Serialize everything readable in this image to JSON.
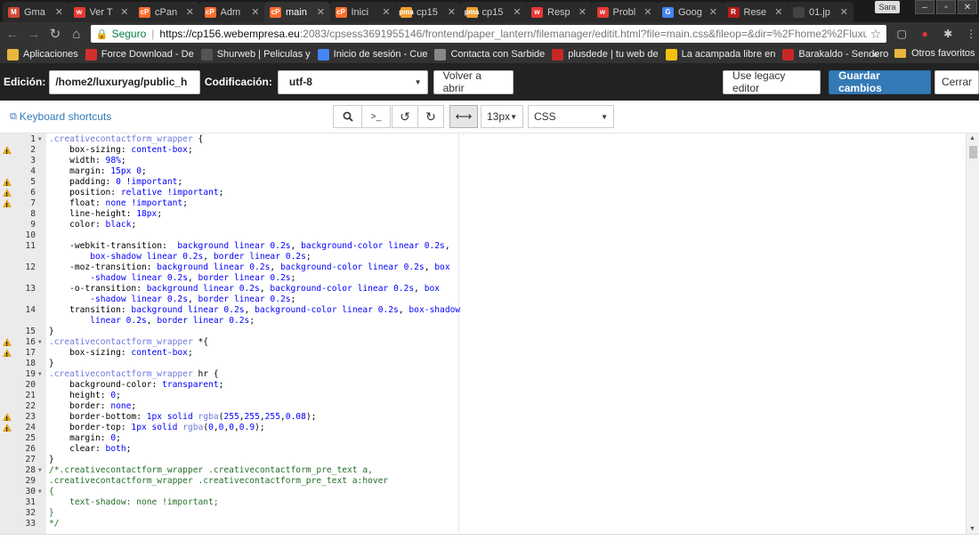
{
  "browser": {
    "tabs": [
      {
        "label": "Gma",
        "icon": "gmail-icon",
        "color": "#d14836",
        "glyph": "M"
      },
      {
        "label": "Ver T",
        "icon": "webempresa-icon",
        "color": "#e53935",
        "glyph": "w"
      },
      {
        "label": "cPan",
        "icon": "cpanel-icon",
        "color": "#ff6c2c",
        "glyph": "cP"
      },
      {
        "label": "Adm",
        "icon": "cpanel-icon",
        "color": "#ff6c2c",
        "glyph": "cP"
      },
      {
        "label": "main",
        "icon": "cpanel-icon",
        "color": "#ff6c2c",
        "glyph": "cP",
        "active": true
      },
      {
        "label": "Inici",
        "icon": "cpanel-icon",
        "color": "#ff6c2c",
        "glyph": "cP"
      },
      {
        "label": "cp15",
        "icon": "pma-icon",
        "color": "#f0a030",
        "glyph": "pma"
      },
      {
        "label": "cp15",
        "icon": "pma-icon",
        "color": "#f0a030",
        "glyph": "pma"
      },
      {
        "label": "Resp",
        "icon": "webempresa-icon",
        "color": "#e53935",
        "glyph": "w"
      },
      {
        "label": "Probl",
        "icon": "webempresa-icon",
        "color": "#e53935",
        "glyph": "w"
      },
      {
        "label": "Goog",
        "icon": "google-icon",
        "color": "#4285f4",
        "glyph": "G"
      },
      {
        "label": "Rese",
        "icon": "page-icon",
        "color": "#b71c1c",
        "glyph": "R"
      },
      {
        "label": "01.jp",
        "icon": "image-icon",
        "color": "#444444",
        "glyph": ""
      }
    ],
    "profile": "Sara",
    "url": {
      "secure_label": "Seguro",
      "host": "https://cp156.webempresa.eu",
      "rest": ":2083/cpsess3691955146/frontend/paper_lantern/filemanager/editit.html?file=main.css&fileop=&dir=%2Fhome2%2Fluxuryag%2..."
    },
    "bookmarks": [
      {
        "label": "Aplicaciones",
        "icon": "apps-icon",
        "color": "#e8b63f"
      },
      {
        "label": "Force Download - De",
        "icon": "force-download-icon",
        "color": "#d32f2f"
      },
      {
        "label": "Shurweb | Peliculas y",
        "icon": "shurweb-icon",
        "color": "#555555"
      },
      {
        "label": "Inicio de sesión - Cue",
        "icon": "google-icon",
        "color": "#4285f4"
      },
      {
        "label": "Contacta con Sarbide",
        "icon": "sarbide-icon",
        "color": "#888888"
      },
      {
        "label": "plusdede | tu web de",
        "icon": "plusdede-icon",
        "color": "#c62828"
      },
      {
        "label": "La acampada libre en",
        "icon": "acampada-icon",
        "color": "#f4c20d"
      },
      {
        "label": "Barakaldo - Sendero",
        "icon": "barakaldo-icon",
        "color": "#c62828"
      }
    ],
    "bookmarks_more": "»",
    "other_bookmarks": "Otros favoritos"
  },
  "toolbar": {
    "edit_label": "Edición:",
    "path_value": "/home2/luxuryag/public_h",
    "encoding_label": "Codificación:",
    "encoding_value": "utf-8",
    "reopen_label": "Volver a abrir",
    "legacy_label": "Use legacy editor",
    "save_label": "Guardar cambios",
    "close_label": "Cerrar"
  },
  "subtoolbar": {
    "shortcuts_label": "Keyboard shortcuts",
    "font_size": "13px",
    "mode": "CSS"
  },
  "code_lines": [
    {
      "n": "1",
      "fold": true,
      "warn": false,
      "html": "<span class='sel'>.creativecontactform_wrapper</span> {"
    },
    {
      "n": "2",
      "warn": true,
      "html": "    box-sizing: <span class='val'>content-box</span>;"
    },
    {
      "n": "3",
      "warn": false,
      "html": "    width: <span class='num-c'>98%</span>;"
    },
    {
      "n": "4",
      "warn": false,
      "html": "    margin: <span class='num-c'>15px</span> <span class='num-c'>0</span>;"
    },
    {
      "n": "5",
      "warn": true,
      "html": "    padding: <span class='num-c'>0</span> <span class='imp'>!important</span>;"
    },
    {
      "n": "6",
      "warn": true,
      "html": "    position: <span class='val'>relative</span> <span class='imp'>!important</span>;"
    },
    {
      "n": "7",
      "warn": true,
      "html": "    float: <span class='val'>none</span> <span class='imp'>!important</span>;"
    },
    {
      "n": "8",
      "warn": false,
      "html": "    line-height: <span class='num-c'>18px</span>;"
    },
    {
      "n": "9",
      "warn": false,
      "html": "    color: <span class='val'>black</span>;"
    },
    {
      "n": "10",
      "warn": false,
      "html": ""
    },
    {
      "n": "11",
      "warn": false,
      "html": "    -webkit-transition:  <span class='val'>background</span> <span class='val'>linear</span> <span class='num-c'>0.2s</span>, <span class='val'>background-color</span> <span class='val'>linear</span> <span class='num-c'>0.2s</span>,"
    },
    {
      "n": "",
      "warn": false,
      "html": "        <span class='val'>box-shadow</span> <span class='val'>linear</span> <span class='num-c'>0.2s</span>, <span class='val'>border</span> <span class='val'>linear</span> <span class='num-c'>0.2s</span>;"
    },
    {
      "n": "12",
      "warn": false,
      "html": "    -moz-transition: <span class='val'>background</span> <span class='val'>linear</span> <span class='num-c'>0.2s</span>, <span class='val'>background-color</span> <span class='val'>linear</span> <span class='num-c'>0.2s</span>, <span class='val'>box</span>"
    },
    {
      "n": "",
      "warn": false,
      "html": "        <span class='val'>-shadow</span> <span class='val'>linear</span> <span class='num-c'>0.2s</span>, <span class='val'>border</span> <span class='val'>linear</span> <span class='num-c'>0.2s</span>;"
    },
    {
      "n": "13",
      "warn": false,
      "html": "    -o-transition: <span class='val'>background</span> <span class='val'>linear</span> <span class='num-c'>0.2s</span>, <span class='val'>background-color</span> <span class='val'>linear</span> <span class='num-c'>0.2s</span>, <span class='val'>box</span>"
    },
    {
      "n": "",
      "warn": false,
      "html": "        <span class='val'>-shadow</span> <span class='val'>linear</span> <span class='num-c'>0.2s</span>, <span class='val'>border</span> <span class='val'>linear</span> <span class='num-c'>0.2s</span>;"
    },
    {
      "n": "14",
      "warn": false,
      "html": "    transition: <span class='val'>background</span> <span class='val'>linear</span> <span class='num-c'>0.2s</span>, <span class='val'>background-color</span> <span class='val'>linear</span> <span class='num-c'>0.2s</span>, <span class='val'>box-shadow</span>"
    },
    {
      "n": "",
      "warn": false,
      "html": "        <span class='val'>linear</span> <span class='num-c'>0.2s</span>, <span class='val'>border</span> <span class='val'>linear</span> <span class='num-c'>0.2s</span>;"
    },
    {
      "n": "15",
      "warn": false,
      "html": "}"
    },
    {
      "n": "16",
      "fold": true,
      "warn": true,
      "html": "<span class='sel'>.creativecontactform_wrapper</span> *{"
    },
    {
      "n": "17",
      "warn": true,
      "html": "    box-sizing: <span class='val'>content-box</span>;"
    },
    {
      "n": "18",
      "warn": false,
      "html": "}"
    },
    {
      "n": "19",
      "fold": true,
      "warn": false,
      "html": "<span class='sel'>.creativecontactform_wrapper</span> hr {"
    },
    {
      "n": "20",
      "warn": false,
      "html": "    background-color: <span class='val'>transparent</span>;"
    },
    {
      "n": "21",
      "warn": false,
      "html": "    height: <span class='num-c'>0</span>;"
    },
    {
      "n": "22",
      "warn": false,
      "html": "    border: <span class='val'>none</span>;"
    },
    {
      "n": "23",
      "warn": true,
      "html": "    border-bottom: <span class='num-c'>1px</span> <span class='val'>solid</span> <span class='fn'>rgba</span>(<span class='num-c'>255</span>,<span class='num-c'>255</span>,<span class='num-c'>255</span>,<span class='num-c'>0.08</span>);"
    },
    {
      "n": "24",
      "warn": true,
      "html": "    border-top: <span class='num-c'>1px</span> <span class='val'>solid</span> <span class='fn'>rgba</span>(<span class='num-c'>0</span>,<span class='num-c'>0</span>,<span class='num-c'>0</span>,<span class='num-c'>0.9</span>);"
    },
    {
      "n": "25",
      "warn": false,
      "html": "    margin: <span class='num-c'>0</span>;"
    },
    {
      "n": "26",
      "warn": false,
      "html": "    clear: <span class='val'>both</span>;"
    },
    {
      "n": "27",
      "warn": false,
      "html": "}"
    },
    {
      "n": "28",
      "fold": true,
      "warn": false,
      "html": "<span class='cmt'>/*.creativecontactform_wrapper .creativecontactform_pre_text a,</span>"
    },
    {
      "n": "29",
      "warn": false,
      "html": "<span class='cmt'>.creativecontactform_wrapper .creativecontactform_pre_text a:hover</span>"
    },
    {
      "n": "30",
      "fold": true,
      "warn": false,
      "html": "<span class='cmt'>{</span>"
    },
    {
      "n": "31",
      "warn": false,
      "html": "<span class='cmt'>    text-shadow: none !important;</span>"
    },
    {
      "n": "32",
      "warn": false,
      "html": "<span class='cmt'>}</span>"
    },
    {
      "n": "33",
      "warn": false,
      "html": "<span class='cmt'>*/</span>"
    }
  ]
}
